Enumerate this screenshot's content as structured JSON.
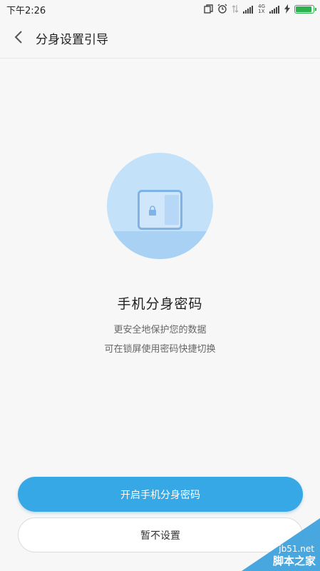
{
  "status_bar": {
    "time": "下午2:26",
    "network_top": "4G",
    "network_bottom": "1X",
    "battery_level": 0.9,
    "battery_color": "#2bb24c"
  },
  "header": {
    "back_icon": "chevron-left-icon",
    "title": "分身设置引导"
  },
  "illustration": {
    "icon": "phone-lock-icon",
    "circle_color": "#c3e1f9"
  },
  "content": {
    "title": "手机分身密码",
    "desc_line1": "更安全地保护您的数据",
    "desc_line2": "可在锁屏使用密码快捷切换"
  },
  "actions": {
    "primary_label": "开启手机分身密码",
    "primary_color": "#37a8e6",
    "secondary_label": "暂不设置"
  },
  "watermark": {
    "domain": "jb51.net",
    "name": "脚本之家"
  }
}
